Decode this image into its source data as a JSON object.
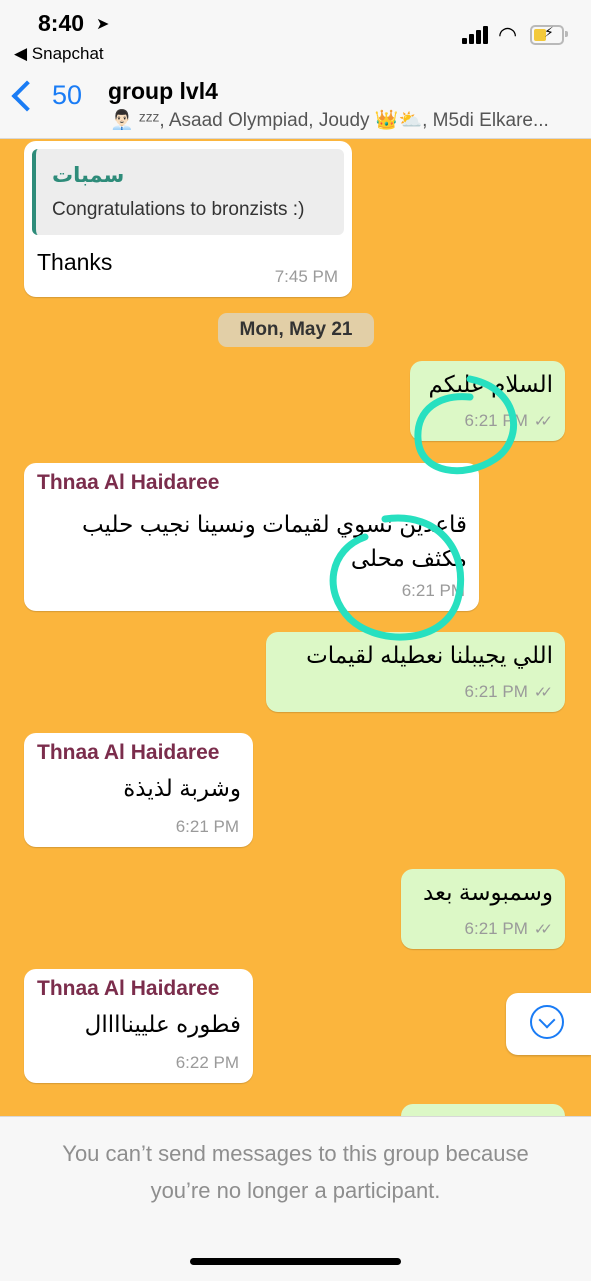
{
  "status_bar": {
    "time": "8:40",
    "back_app": "◀ Snapchat"
  },
  "header": {
    "back_count": "50",
    "title": "group lvl4",
    "members": "👨🏻‍💼 ᶻᶻᶻ, Asaad Olympiad, Joudy 👑⛅, M5di Elkare..."
  },
  "messages": [
    {
      "type": "incoming",
      "quote_name": "سمبات",
      "quote_text": "Congratulations to bronzists :)",
      "text": "Thanks",
      "time": "7:45 PM"
    },
    {
      "type": "date",
      "text": "Mon, May 21"
    },
    {
      "type": "outgoing",
      "text": "السلام عليكم",
      "time": "6:21 PM"
    },
    {
      "type": "incoming",
      "sender": "Thnaa Al Haidaree",
      "text": "قاعدين نسوي لقيمات ونسينا نجيب حليب مكثف محلى",
      "time": "6:21 PM"
    },
    {
      "type": "outgoing",
      "text": "اللي يجيبلنا نعطيله لقيمات",
      "time": "6:21 PM"
    },
    {
      "type": "incoming",
      "sender": "Thnaa Al Haidaree",
      "text": "وشربة لذيذة",
      "time": "6:21 PM"
    },
    {
      "type": "outgoing",
      "text": "وسمبوسة بعد",
      "time": "6:21 PM"
    },
    {
      "type": "incoming",
      "sender": "Thnaa Al Haidaree",
      "text": "فطوره علييناااال",
      "time": "6:22 PM"
    }
  ],
  "footer": {
    "notice": "You can’t send messages to this group because you’re no longer a participant."
  },
  "colors": {
    "chat_bg": "#fbb53d",
    "outgoing": "#dcf8c6",
    "incoming": "#ffffff",
    "accent": "#1a7cf5",
    "annotation": "#27e0c0"
  },
  "icons": [
    "location-arrow-icon",
    "signal-icon",
    "wifi-icon",
    "battery-icon",
    "back-chevron-icon",
    "double-check-icon",
    "scroll-down-icon"
  ]
}
